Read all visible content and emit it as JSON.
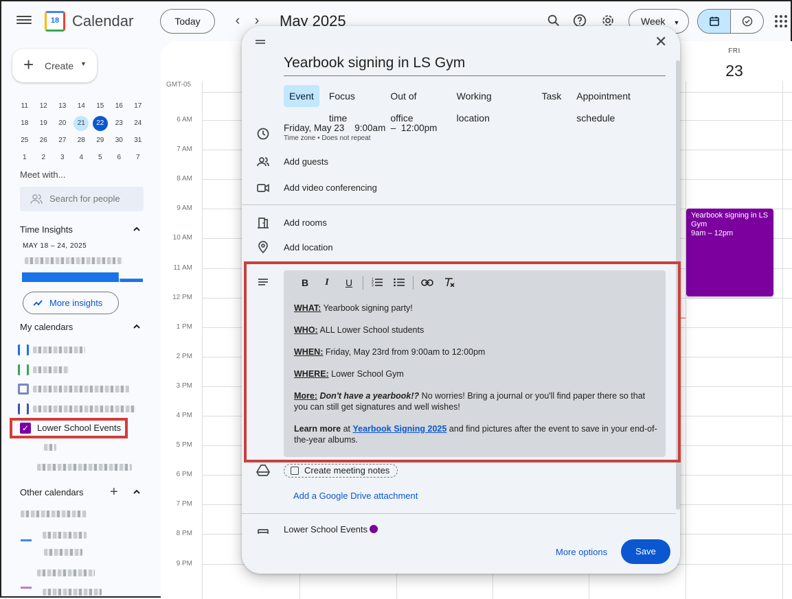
{
  "app": {
    "title": "Calendar",
    "logo_day": "18"
  },
  "toolbar": {
    "today_label": "Today",
    "prev_label": "‹",
    "next_label": "›",
    "month_title": "May 2025",
    "view_label": "Week",
    "icons": [
      "search-icon",
      "help-icon",
      "settings-icon",
      "calendar-view-icon",
      "tasks-icon",
      "apps-grid-icon"
    ]
  },
  "sidebar": {
    "create_label": "Create",
    "mini_calendar": {
      "weeks": [
        [
          "11",
          "12",
          "13",
          "14",
          "15",
          "16",
          "17"
        ],
        [
          "18",
          "19",
          "20",
          "21",
          "22",
          "23",
          "24"
        ],
        [
          "25",
          "26",
          "27",
          "28",
          "29",
          "30",
          "31"
        ],
        [
          "1",
          "2",
          "3",
          "4",
          "5",
          "6",
          "7"
        ]
      ],
      "today": "21",
      "selected": "22"
    },
    "meet_with": "Meet with...",
    "search_people_placeholder": "Search for people",
    "time_insights": {
      "title": "Time Insights",
      "range": "MAY 18 – 24, 2025",
      "more_label": "More insights"
    },
    "my_calendars": {
      "title": "My calendars",
      "highlighted": "Lower School Events"
    },
    "other_calendars": {
      "title": "Other calendars"
    }
  },
  "grid": {
    "timezone": "GMT-05",
    "day_header": {
      "dow": "FRI",
      "date": "23"
    },
    "hours": [
      "6 AM",
      "7 AM",
      "8 AM",
      "9 AM",
      "10 AM",
      "11 AM",
      "12 PM",
      "1 PM",
      "2 PM",
      "3 PM",
      "4 PM",
      "5 PM",
      "6 PM",
      "7 PM",
      "8 PM",
      "9 PM"
    ],
    "event_chip": {
      "title": "Yearbook signing in LS Gym",
      "time": "9am – 12pm",
      "color": "#7b009e"
    }
  },
  "dialog": {
    "title": "Yearbook signing in LS Gym",
    "tabs": [
      "Event",
      "Focus time",
      "Out of office",
      "Working location",
      "Task",
      "Appointment schedule"
    ],
    "date_time": "Friday, May 23    9:00am  –  12:00pm",
    "date_sub": "Time zone • Does not repeat",
    "add_guests": "Add guests",
    "add_video": "Add video conferencing",
    "add_rooms": "Add rooms",
    "add_location": "Add location",
    "description": {
      "what_k": "WHAT:",
      "what_v": " Yearbook signing party!",
      "who_k": "WHO:",
      "who_v": " ALL Lower School students",
      "when_k": "WHEN:",
      "when_v": " Friday, May 23rd from 9:00am to 12:00pm",
      "where_k": "WHERE:",
      "where_v": " Lower School Gym",
      "more_k": "More:",
      "more_em": "Don't have a yearbook!?",
      "more_v": " No worries! Bring a journal or you'll find paper there so that you can still get signatures and well wishes!",
      "learn_b": "Learn more",
      "learn_pre": " at ",
      "learn_link": "Yearbook Signing 2025",
      "learn_post": " and find pictures after the event to save in your end-of-the-year albums."
    },
    "meeting_notes": "Create meeting notes",
    "drive_attachment": "Add a Google Drive attachment",
    "calendar_name": "Lower School Events",
    "more_options": "More options",
    "save": "Save"
  }
}
